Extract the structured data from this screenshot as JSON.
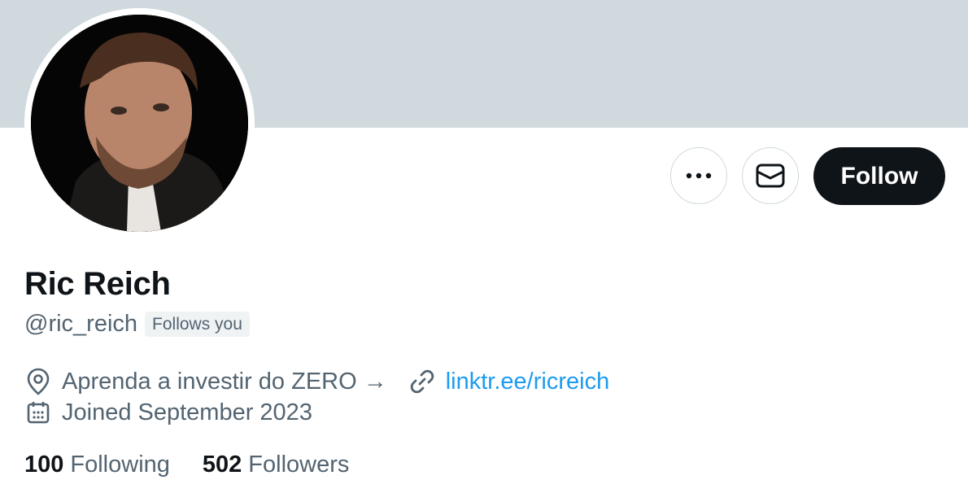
{
  "profile": {
    "display_name": "Ric Reich",
    "handle": "@ric_reich",
    "follows_you_badge": "Follows you",
    "bio_location": "Aprenda a investir do ZERO →",
    "website": "linktr.ee/ricreich",
    "joined": "Joined September 2023"
  },
  "actions": {
    "more_icon": "more-horizontal-icon",
    "message_icon": "envelope-icon",
    "follow_label": "Follow"
  },
  "stats": {
    "following_count": "100",
    "following_label": "Following",
    "followers_count": "502",
    "followers_label": "Followers"
  },
  "colors": {
    "banner": "#cfd9de",
    "primary_text": "#0f1419",
    "secondary_text": "#536471",
    "link": "#1d9bf0",
    "follow_button": "#0f1419"
  }
}
